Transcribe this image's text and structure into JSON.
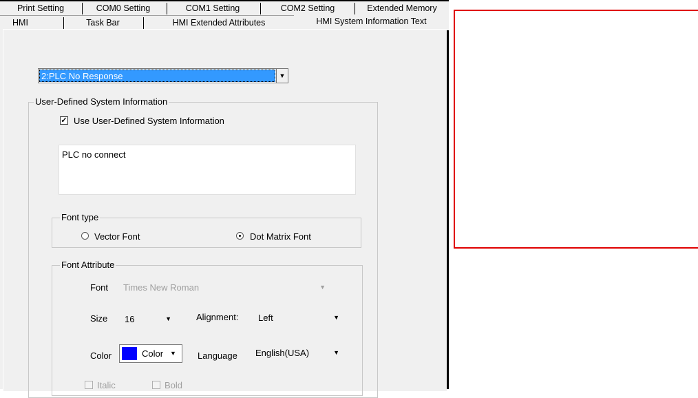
{
  "tabs_row1": [
    "Print Setting",
    "COM0 Setting",
    "COM1 Setting",
    "COM2 Setting",
    "Extended Memory"
  ],
  "tabs_row2": [
    "HMI",
    "Task Bar",
    "HMI Extended Attributes",
    "HMI System Information Text"
  ],
  "message_select": {
    "value": "2:PLC No Response"
  },
  "user_defined": {
    "group_title": "User-Defined System Information",
    "checkbox_label": "Use User-Defined System Information",
    "checked": true,
    "text": "PLC no connect"
  },
  "font_type": {
    "group_title": "Font type",
    "vector_label": "Vector Font",
    "dot_matrix_label": "Dot Matrix Font",
    "selected": "Dot Matrix Font"
  },
  "font_attribute": {
    "group_title": "Font Attribute",
    "font_label": "Font",
    "font_value": "Times New Roman",
    "size_label": "Size",
    "size_value": "16",
    "alignment_label": "Alignment:",
    "alignment_value": "Left",
    "color_label": "Color",
    "color_button_label": "Color",
    "color_swatch": "#0000ff",
    "language_label": "Language",
    "language_value": "English(USA)",
    "italic_label": "Italic",
    "bold_label": "Bold"
  },
  "colors": {
    "highlight_box": "#e00000",
    "selection": "#3399ff"
  }
}
